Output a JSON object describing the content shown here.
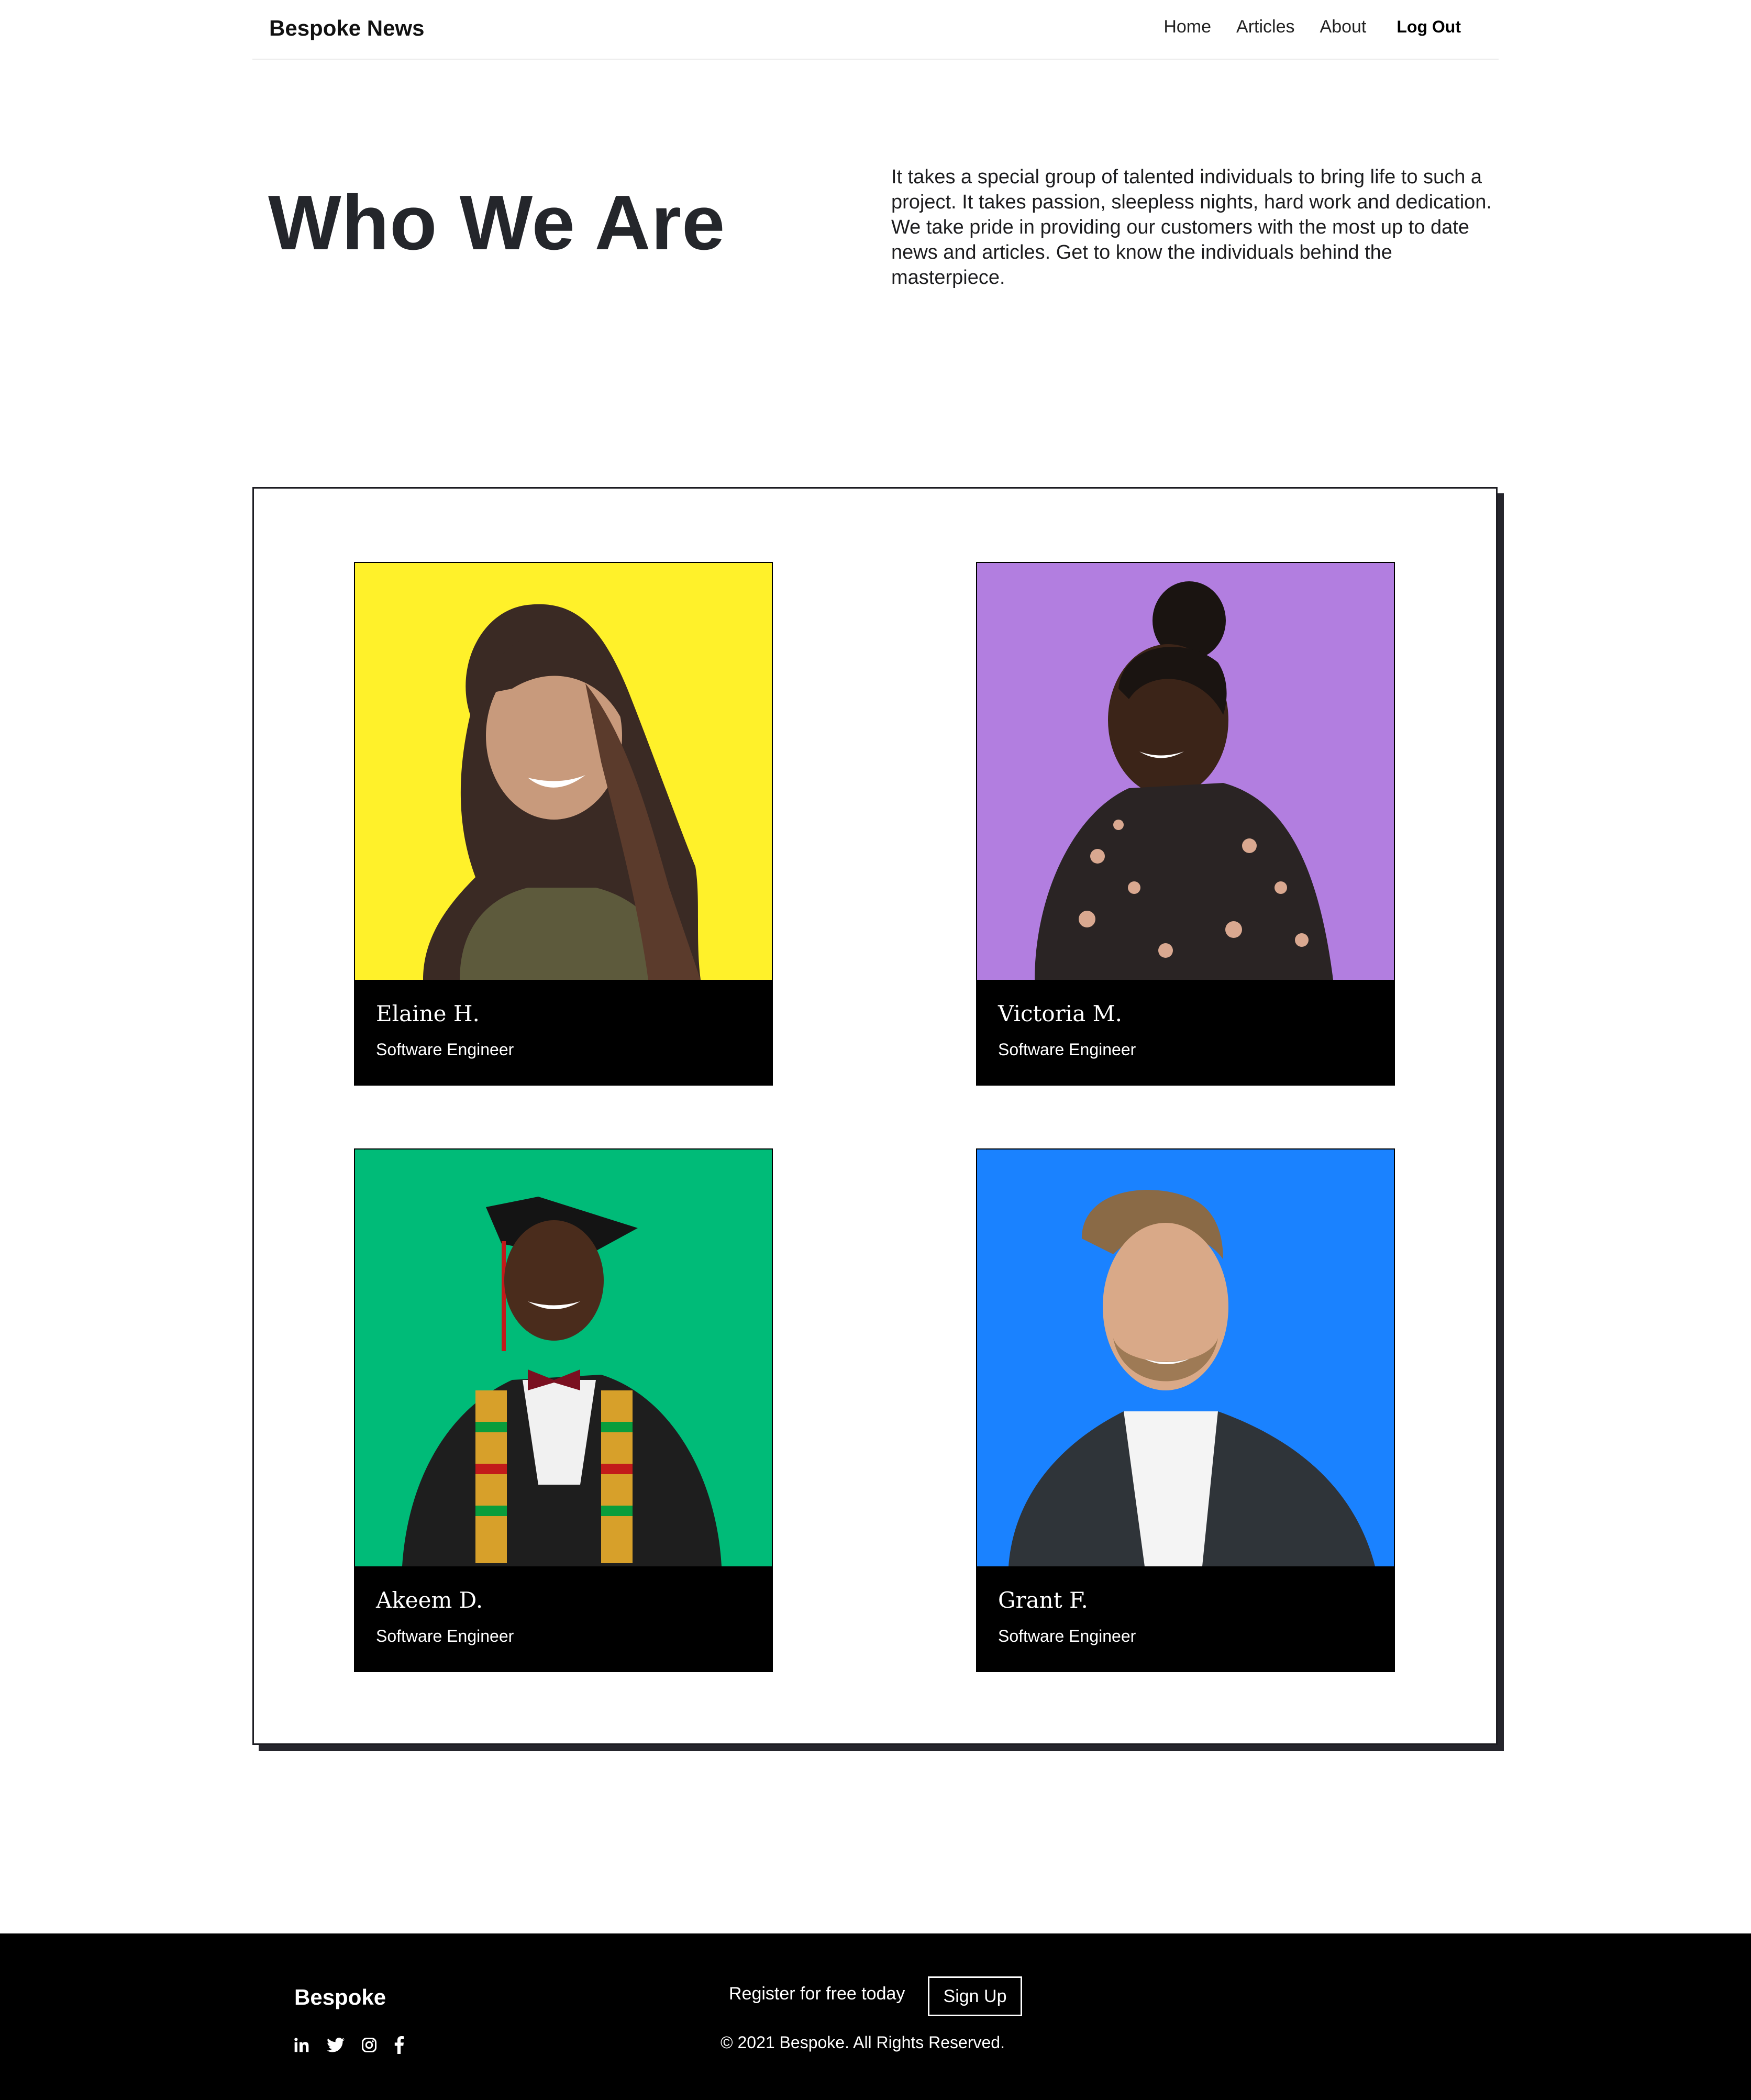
{
  "nav": {
    "brand": "Bespoke News",
    "links": [
      "Home",
      "Articles",
      "About"
    ],
    "logout": "Log Out"
  },
  "hero": {
    "title": "Who We Are",
    "text": "It takes a special group of talented individuals to bring life to such a project. It takes passion, sleepless nights, hard work and dedication. We take pride in providing our customers with the most up to date news and articles. Get to know the individuals behind the masterpiece."
  },
  "team": [
    {
      "name": "Elaine H.",
      "role": "Software Engineer",
      "bg": "#fff12a"
    },
    {
      "name": "Victoria M.",
      "role": "Software Engineer",
      "bg": "#b27ee0"
    },
    {
      "name": "Akeem D.",
      "role": "Software Engineer",
      "bg": "#00bb78"
    },
    {
      "name": "Grant F.",
      "role": "Software Engineer",
      "bg": "#1a82ff"
    }
  ],
  "footer": {
    "brand": "Bespoke",
    "register": "Register for free today",
    "signup": "Sign Up",
    "copyright": "© 2021 Bespoke. All Rights Reserved.",
    "social_icons": [
      "linkedin-icon",
      "twitter-icon",
      "instagram-icon",
      "facebook-icon"
    ]
  }
}
